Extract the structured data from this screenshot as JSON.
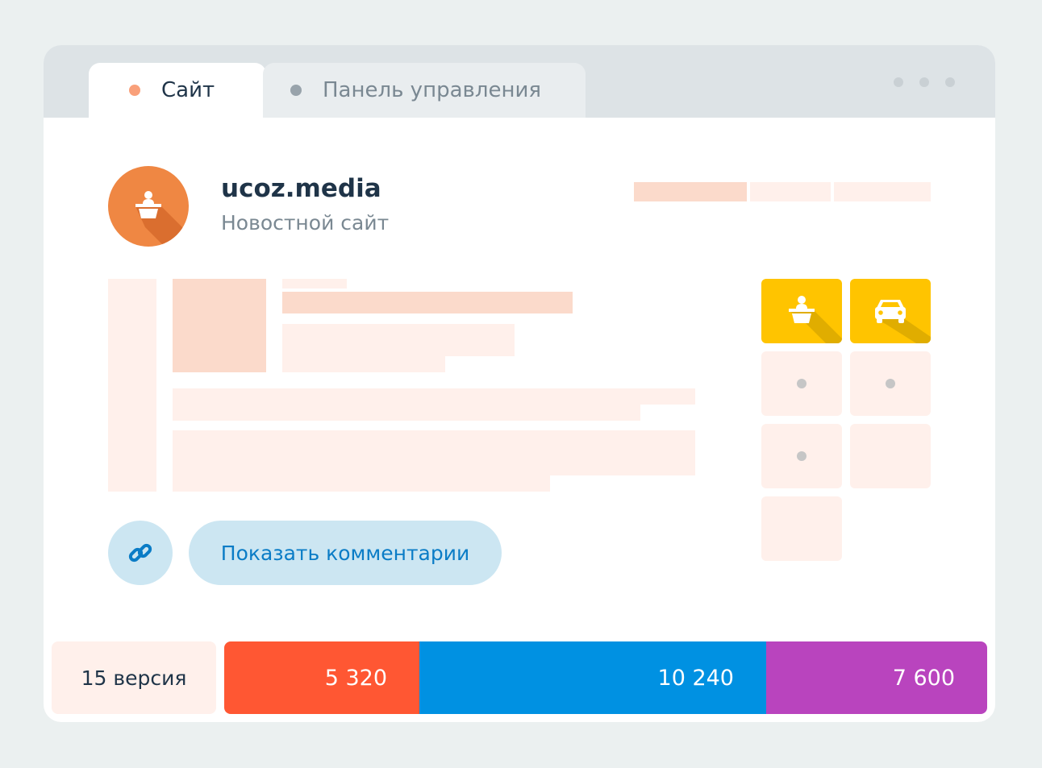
{
  "tabs": [
    {
      "label": "Сайт",
      "dot_color": "#f9a07a",
      "active": true
    },
    {
      "label": "Панель управления",
      "dot_color": "#98a3ab",
      "active": false
    }
  ],
  "site": {
    "name": "ucoz.media",
    "description": "Новостной сайт",
    "avatar_icon": "podium-speaker-icon",
    "avatar_color": "#ef8743"
  },
  "category_tiles": [
    {
      "icon": "podium-speaker-icon",
      "color": "#ffc400"
    },
    {
      "icon": "car-icon",
      "color": "#ffc400"
    }
  ],
  "buttons": {
    "link_icon": "link-icon",
    "show_comments": "Показать комментарии"
  },
  "stats": {
    "version_label": "15 версия",
    "segments": [
      {
        "value": "5 320",
        "color": "#ff5733"
      },
      {
        "value": "10 240",
        "color": "#0091e2"
      },
      {
        "value": "7 600",
        "color": "#b944be"
      }
    ]
  }
}
